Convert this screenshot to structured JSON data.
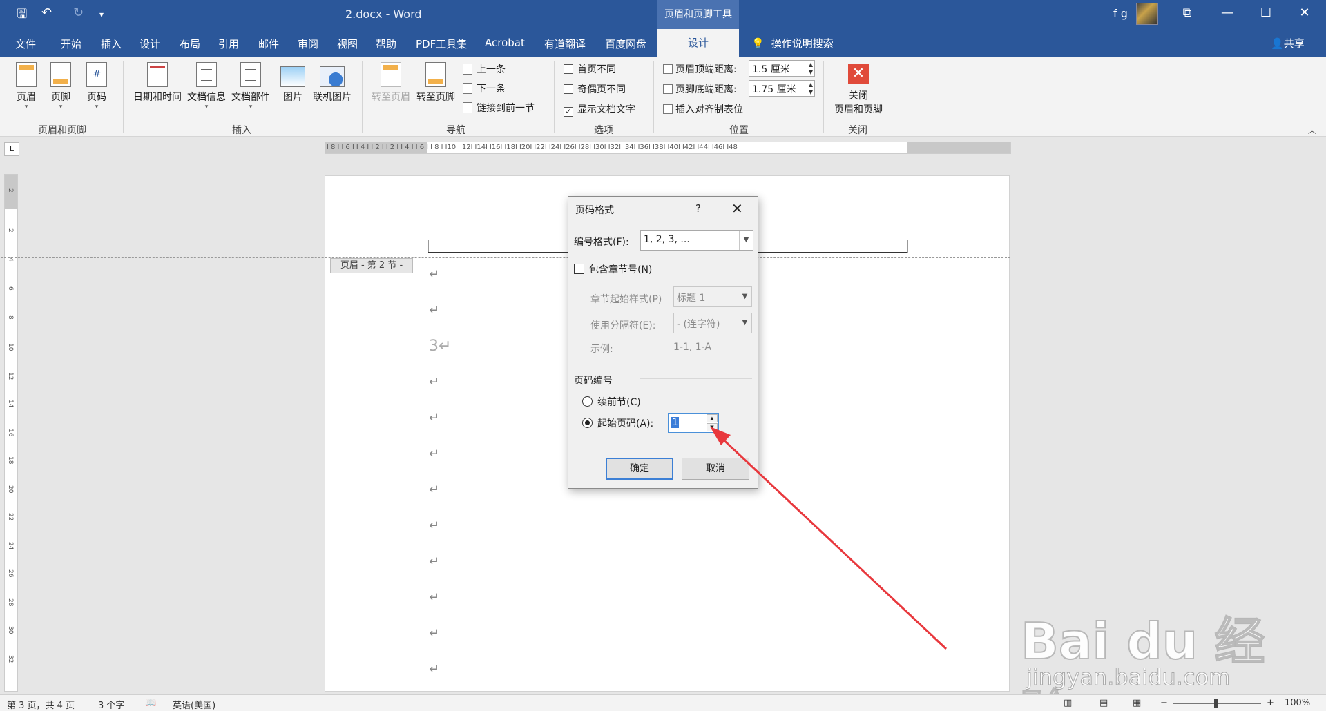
{
  "titlebar": {
    "doc_title": "2.docx  -  Word",
    "contextual_tab": "页眉和页脚工具",
    "user": "f g",
    "qa_save": "🖫",
    "qa_undo": "↶",
    "qa_redo": "↻",
    "qa_more": "▾",
    "win_ribbon_opts": "⧉",
    "win_min": "—",
    "win_max": "☐",
    "win_close": "✕"
  },
  "tabs": [
    "文件",
    "开始",
    "插入",
    "设计",
    "布局",
    "引用",
    "邮件",
    "审阅",
    "视图",
    "帮助",
    "PDF工具集",
    "Acrobat",
    "有道翻译",
    "百度网盘"
  ],
  "active_tab": "设计",
  "search": "操作说明搜索",
  "share": "共享",
  "ribbon": {
    "header": "页眉",
    "footer": "页脚",
    "page_number": "页码",
    "group_hf": "页眉和页脚",
    "datetime": "日期和时间",
    "doc_info": "文档信息",
    "doc_parts": "文档部件",
    "picture": "图片",
    "online_picture": "联机图片",
    "group_insert": "插入",
    "goto_header": "转至页眉",
    "goto_footer": "转至页脚",
    "prev": "上一条",
    "next": "下一条",
    "link_prev": "链接到前一节",
    "group_nav": "导航",
    "diff_first": "首页不同",
    "diff_odd_even": "奇偶页不同",
    "show_doc_text": "显示文档文字",
    "group_options": "选项",
    "header_top": "页眉顶端距离:",
    "header_top_val": "1.5 厘米",
    "footer_bottom": "页脚底端距离:",
    "footer_bottom_val": "1.75 厘米",
    "insert_align_tab": "插入对齐制表位",
    "group_position": "位置",
    "close_hf_1": "关闭",
    "close_hf_2": "页眉和页脚",
    "group_close": "关闭"
  },
  "ruler": {
    "h_ticks": "l 8 l   l 6 l   l 4 l   l 2 l       l 2 l   l 4 l   l 6 l   l 8 l   l10l   l12l   l14l   l16l   l18l   l20l   l22l   l24l   l26l   l28l   l30l   l32l   l34l   l36l   l38l   l40l   l42l   l44l   l46l   l48",
    "v_ticks": [
      "2",
      "2",
      "4",
      "6",
      "8",
      "10",
      "12",
      "14",
      "16",
      "18",
      "20",
      "22",
      "24",
      "26",
      "28",
      "30",
      "32"
    ],
    "corner": "L"
  },
  "document": {
    "header_tag": "页眉 - 第 2 节 -",
    "para_mark": "↵",
    "page_num_text": "3↵"
  },
  "dialog": {
    "title": "页码格式",
    "help": "?",
    "close": "✕",
    "number_format_label": "编号格式(F):",
    "number_format_value": "1, 2, 3, ...",
    "include_chapter": "包含章节号(N)",
    "chapter_style_label": "章节起始样式(P)",
    "chapter_style_value": "标题 1",
    "separator_label": "使用分隔符(E):",
    "separator_value": "-   (连字符)",
    "example_label": "示例:",
    "example_value": "1-1, 1-A",
    "page_numbering": "页码编号",
    "continue_prev": "续前节(C)",
    "start_at": "起始页码(A):",
    "start_at_value": "1",
    "ok": "确定",
    "cancel": "取消",
    "include_chapter_checked": false,
    "continue_prev_selected": false,
    "start_at_selected": true
  },
  "watermark": {
    "logo": "Bai du 经验",
    "url": "jingyan.baidu.com"
  },
  "status": {
    "page": "第 3 页，共 4 页",
    "words": "3 个字",
    "lang": "英语(美国)",
    "zoom": "100%",
    "zoom_minus": "−",
    "zoom_plus": "+"
  },
  "colors": {
    "brand": "#2b579a",
    "arrow": "#e8383d"
  }
}
